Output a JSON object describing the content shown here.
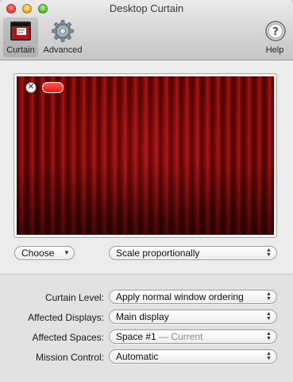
{
  "window": {
    "title": "Desktop Curtain"
  },
  "toolbar": {
    "curtain_label": "Curtain",
    "advanced_label": "Advanced",
    "help_label": "Help",
    "help_glyph": "?"
  },
  "preview": {
    "close_glyph": "✕"
  },
  "controls": {
    "choose_value": "Choose",
    "scale_value": "Scale proportionally"
  },
  "settings": {
    "curtain_level": {
      "label": "Curtain Level:",
      "value": "Apply normal window ordering"
    },
    "affected_displays": {
      "label": "Affected Displays:",
      "value": "Main display"
    },
    "affected_spaces": {
      "label": "Affected Spaces:",
      "value": "Space #1",
      "note": "— Current"
    },
    "mission_control": {
      "label": "Mission Control:",
      "value": "Automatic"
    }
  },
  "colors": {
    "curtain_red": "#a31414",
    "pill_red": "#e11a10"
  },
  "icons": [
    "curtain-icon",
    "gear-icon",
    "help-icon",
    "close-icon",
    "popup-arrows-icon"
  ]
}
